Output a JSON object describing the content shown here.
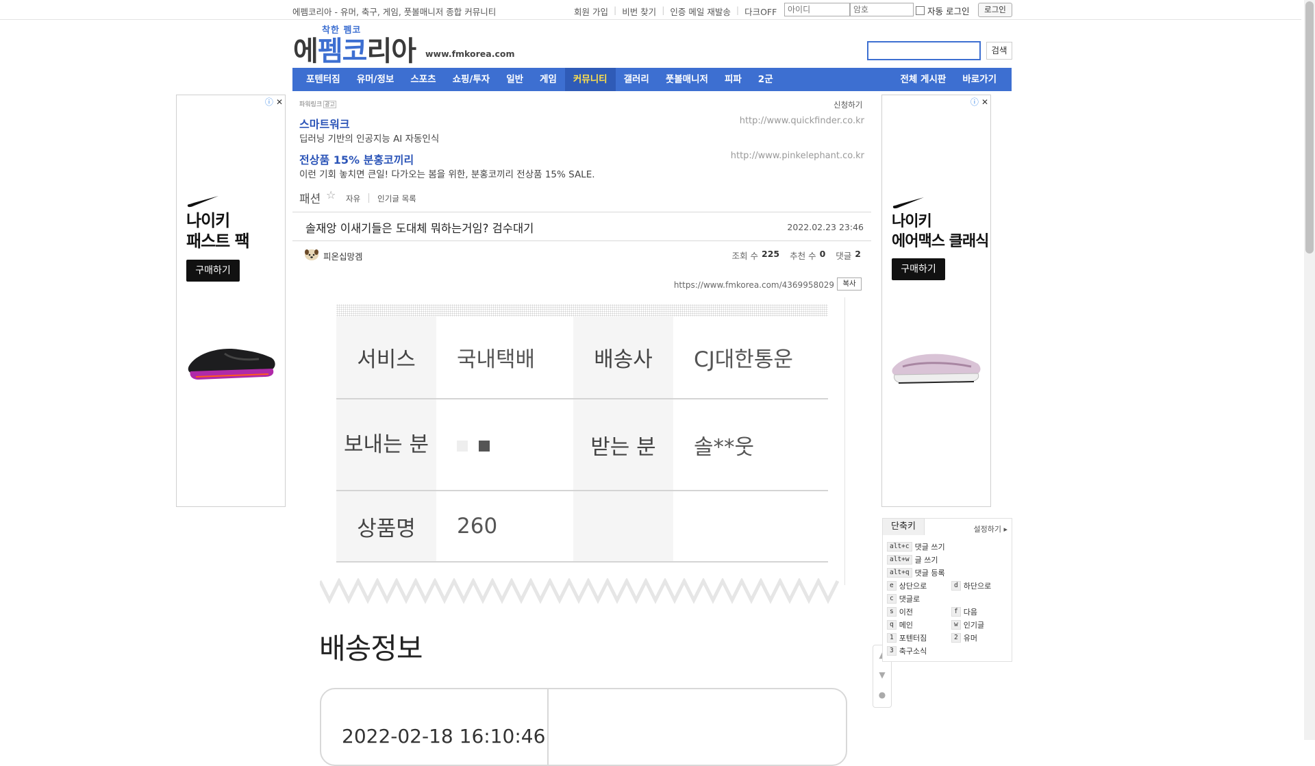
{
  "topbar": {
    "tagline": "에펨코리아 - 유머, 축구, 게임, 풋볼매니저 종합 커뮤니티",
    "links": [
      "회원 가입",
      "비번 찾기",
      "인증 메일 재발송",
      "다크OFF"
    ],
    "id_placeholder": "아이디",
    "pw_placeholder": "암호",
    "autologin_label": "자동 로그인",
    "login_label": "로그인"
  },
  "header": {
    "logo_small": "착한 펨코",
    "logo_a": "에",
    "logo_b": "펨",
    "logo_c": "코",
    "logo_d": "리아",
    "url": "www.fmkorea.com",
    "search_label": "검색"
  },
  "nav": {
    "items": [
      "포텐터짐",
      "유머/정보",
      "스포츠",
      "쇼핑/투자",
      "일반",
      "게임",
      "커뮤니티",
      "갤러리",
      "풋볼매니저",
      "피파",
      "2군"
    ],
    "active": "커뮤니티",
    "right": [
      "전체 게시판",
      "바로가기"
    ]
  },
  "left_ad": {
    "title_line1": "나이키",
    "title_line2": "패스트 팩",
    "buy_label": "구매하기"
  },
  "right_ad": {
    "title_line1": "나이키",
    "title_line2": "에어맥스 클래식",
    "buy_label": "구매하기"
  },
  "text_ads": {
    "label": "파워링크",
    "label_tag": "광고",
    "apply": "신청하기",
    "items": [
      {
        "title": "스마트워크",
        "desc": "딥러닝 기반의 인공지능 AI 자동인식",
        "url": "http://www.quickfinder.co.kr"
      },
      {
        "title": "전상품 15% 분홍코끼리",
        "desc": "이런 기회 놓치면 큰일! 다가오는 봄을 위한, 분홍코끼리 전상품 15% SALE.",
        "url": "http://www.pinkelephant.co.kr"
      }
    ]
  },
  "board": {
    "name": "패션",
    "links": [
      "자유",
      "인기글 목록"
    ]
  },
  "post": {
    "title": "솔재앙 이새기들은 도대체 뭐하는거임? 검수대기",
    "date": "2022.02.23 23:46",
    "author": "피온십망겜",
    "views_label": "조회 수",
    "views": "225",
    "votes_label": "추천 수",
    "votes": "0",
    "comments_label": "댓글",
    "comments": "2",
    "url": "https://www.fmkorea.com/4369958029",
    "copy_label": "복사"
  },
  "shipping_table": {
    "rows": [
      [
        "서비스",
        "국내택배",
        "배송사",
        "CJ대한통운"
      ],
      [
        "보내는 분",
        "",
        "받는 분",
        "솔**웃"
      ],
      [
        "상품명",
        "260",
        "",
        ""
      ]
    ]
  },
  "shipping_info": {
    "title": "배송정보",
    "date": "2022-02-18 16:10:46"
  },
  "shortcuts": {
    "tab": "단축키",
    "setting": "설정하기",
    "items": [
      {
        "key": "alt+c",
        "label": "댓글 쓰기"
      },
      {
        "key": "alt+w",
        "label": "글 쓰기"
      },
      {
        "key": "alt+q",
        "label": "댓글 등록"
      },
      {
        "key": "e",
        "label": "상단으로"
      },
      {
        "key": "d",
        "label": "하단으로"
      },
      {
        "key": "c",
        "label": "댓글로"
      },
      {
        "key": "s",
        "label": "이전"
      },
      {
        "key": "f",
        "label": "다음"
      },
      {
        "key": "q",
        "label": "메인"
      },
      {
        "key": "w",
        "label": "인기글"
      },
      {
        "key": "1",
        "label": "포텐터짐"
      },
      {
        "key": "2",
        "label": "유머"
      },
      {
        "key": "3",
        "label": "축구소식"
      }
    ]
  },
  "colors": {
    "brand": "#3d6fd1",
    "nav_active_text": "#ffe04c"
  }
}
